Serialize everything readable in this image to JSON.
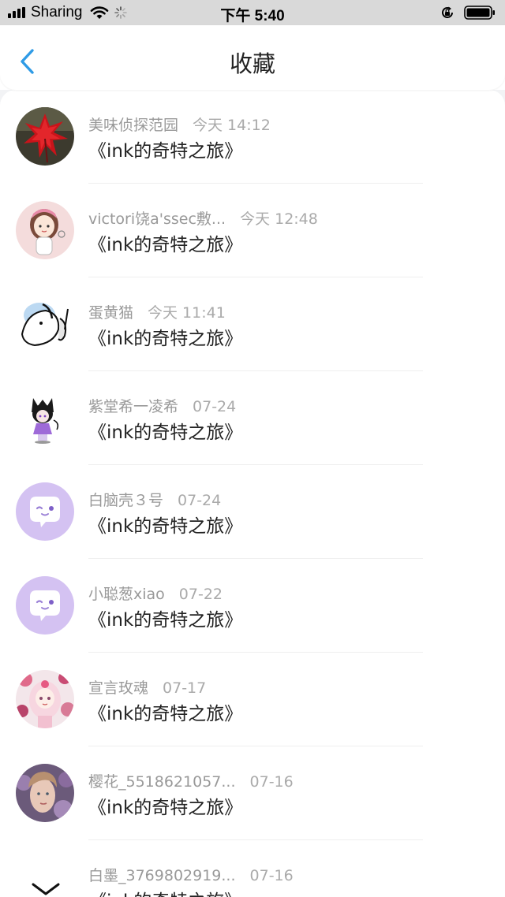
{
  "status_bar": {
    "carrier": "Sharing",
    "time": "下午 5:40",
    "icons": [
      "signal-icon",
      "wifi-icon",
      "loading-spinner-icon",
      "rotation-lock-icon",
      "battery-icon"
    ]
  },
  "header": {
    "title": "收藏",
    "back_icon": "chevron-left-icon"
  },
  "colors": {
    "accent": "#2f9be6",
    "status_bar_bg": "#d9d9d9",
    "meta_text": "#999999",
    "bot_avatar": "#d4c2f2"
  },
  "items": [
    {
      "name": "美味侦探范园",
      "time": "今天 14:12",
      "title": "《ink的奇特之旅》",
      "avatar": "red-leaf-avatar"
    },
    {
      "name": "victori饶a'ssec敷...",
      "time": "今天 12:48",
      "title": "《ink的奇特之旅》",
      "avatar": "cartoon-girl-avatar"
    },
    {
      "name": "蛋黄猫",
      "time": "今天 11:41",
      "title": "《ink的奇特之旅》",
      "avatar": "sketch-character-avatar"
    },
    {
      "name": "紫堂希一凌希",
      "time": "07-24",
      "title": "《ink的奇特之旅》",
      "avatar": "anime-chibi-avatar"
    },
    {
      "name": "白脑壳３号",
      "time": "07-24",
      "title": "《ink的奇特之旅》",
      "avatar": "chat-bubble-avatar"
    },
    {
      "name": "小聪葱xiao",
      "time": "07-22",
      "title": "《ink的奇特之旅》",
      "avatar": "chat-bubble-avatar"
    },
    {
      "name": "宣言玫魂",
      "time": "07-17",
      "title": "《ink的奇特之旅》",
      "avatar": "floral-anime-avatar"
    },
    {
      "name": "樱花_5518621057...",
      "time": "07-16",
      "title": "《ink的奇特之旅》",
      "avatar": "portrait-photo-avatar"
    },
    {
      "name": "白墨_3769802919...",
      "time": "07-16",
      "title": "《ink的奇特之旅》",
      "avatar": "partial-avatar"
    }
  ],
  "scroll_icon": "chevron-down-icon"
}
